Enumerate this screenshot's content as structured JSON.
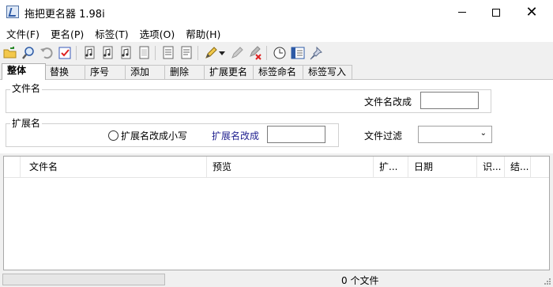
{
  "window": {
    "title": "拖把更名器 1.98i",
    "icon": "app-icon",
    "controls": [
      "minimize-icon",
      "maximize-icon",
      "close-icon"
    ]
  },
  "menu": [
    "文件(F)",
    "更名(P)",
    "标签(T)",
    "选项(O)",
    "帮助(H)"
  ],
  "toolbar": {
    "icons": [
      "open-folder-icon",
      "search-icon",
      "undo-icon",
      "check-icon",
      "file-music-icon",
      "file-music-2-icon",
      "file-music-3-icon",
      "file-icon",
      "list-icon",
      "list-2-icon",
      "pencil-icon",
      "dropdown-arrow-icon",
      "edit-disabled-icon",
      "edit-delete-icon",
      "clock-icon",
      "panel-icon",
      "pin-icon"
    ]
  },
  "tabs": [
    "整体",
    "替换",
    "序号",
    "添加",
    "删除",
    "扩展更名",
    "标签命名",
    "标签写入"
  ],
  "active_tab": "整体",
  "panel": {
    "filename_group_label": "文件名",
    "filename_change_label": "文件名改成",
    "filename_change_value": "",
    "extension_group_label": "扩展名",
    "ext_lowercase_label": "扩展名改成小写",
    "ext_change_label": "扩展名改成",
    "ext_change_value": "",
    "file_filter_label": "文件过滤",
    "file_filter_value": ""
  },
  "list": {
    "columns": [
      "文件名",
      "预览",
      "扩...",
      "日期",
      "识...",
      "结..."
    ],
    "rows": []
  },
  "status": {
    "file_count": "0 个文件",
    "progress": 0
  }
}
